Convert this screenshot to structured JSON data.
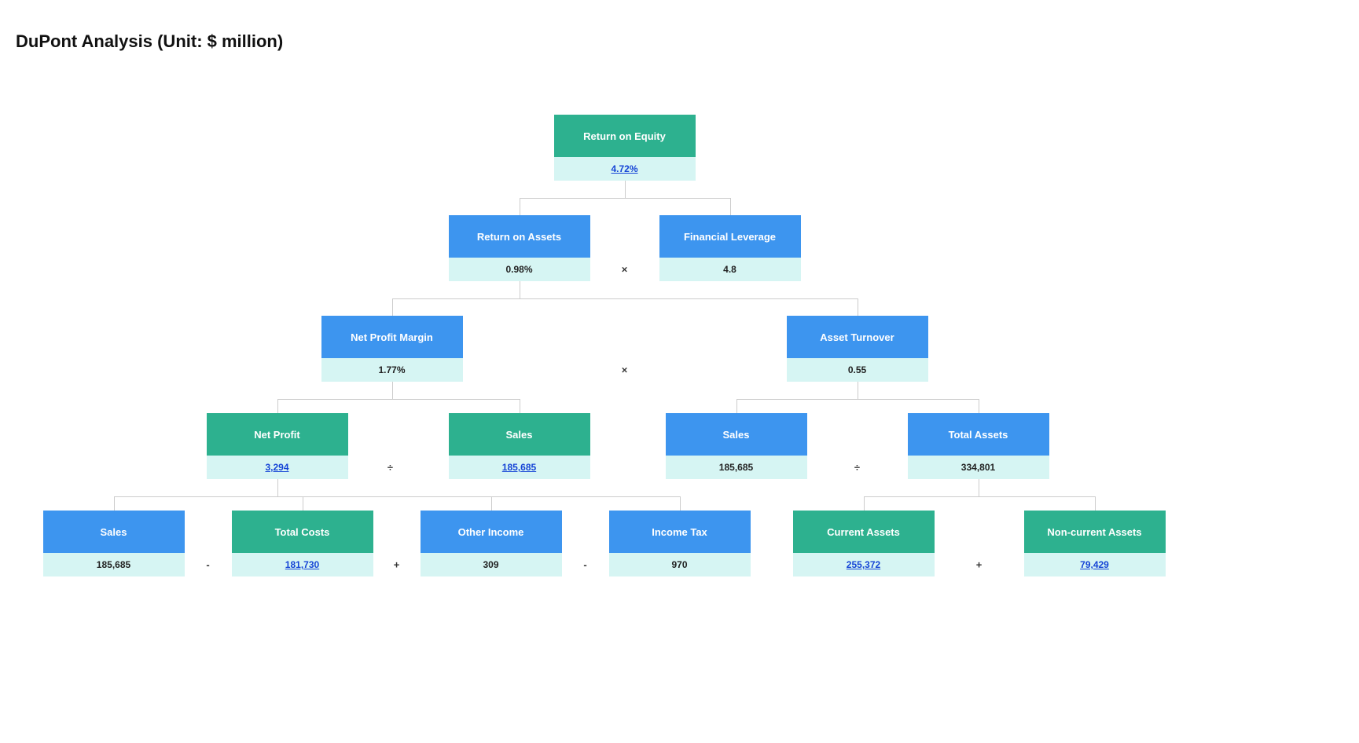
{
  "title": "DuPont Analysis (Unit: $ million)",
  "ops": {
    "mul": "×",
    "div": "÷",
    "plus": "+",
    "minus": "-"
  },
  "nodes": {
    "roe": {
      "label": "Return on Equity",
      "value": "4.72%"
    },
    "roa": {
      "label": "Return on Assets",
      "value": "0.98%"
    },
    "lev": {
      "label": "Financial Leverage",
      "value": "4.8"
    },
    "npm": {
      "label": "Net Profit Margin",
      "value": "1.77%"
    },
    "ato": {
      "label": "Asset Turnover",
      "value": "0.55"
    },
    "np": {
      "label": "Net Profit",
      "value": "3,294"
    },
    "s1": {
      "label": "Sales",
      "value": "185,685"
    },
    "s2": {
      "label": "Sales",
      "value": "185,685"
    },
    "ta": {
      "label": "Total Assets",
      "value": "334,801"
    },
    "s3": {
      "label": "Sales",
      "value": "185,685"
    },
    "tc": {
      "label": "Total Costs",
      "value": "181,730"
    },
    "oi": {
      "label": "Other Income",
      "value": "309"
    },
    "it": {
      "label": "Income Tax",
      "value": "970"
    },
    "ca": {
      "label": "Current Assets",
      "value": "255,372"
    },
    "nca": {
      "label": "Non-current Assets",
      "value": "79,429"
    }
  }
}
